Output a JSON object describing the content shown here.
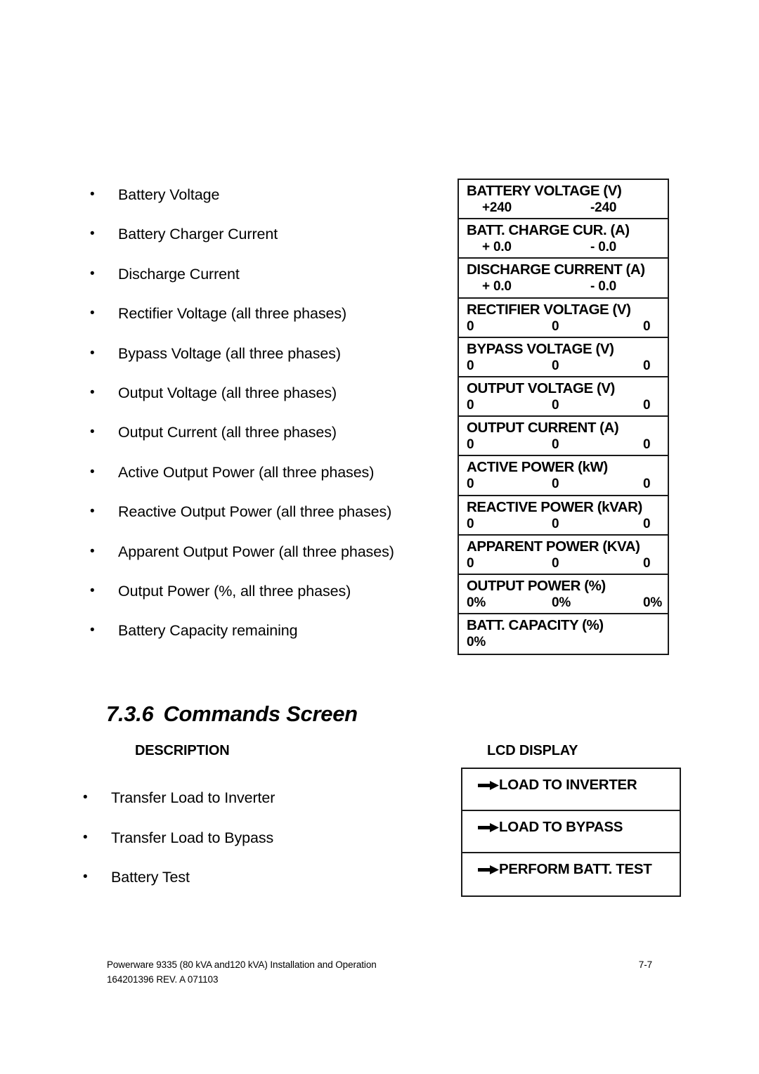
{
  "parameters_section": {
    "descriptions": [
      "Battery Voltage",
      "Battery Charger Current",
      "Discharge Current",
      "Rectifier Voltage (all three phases)",
      "Bypass Voltage (all three phases)",
      "Output Voltage (all three phases)",
      "Output Current (all three phases)",
      "Active Output Power (all three phases)",
      "Reactive Output Power (all three phases)",
      "Apparent Output Power (all three phases)",
      "Output Power (%, all three phases)",
      "Battery Capacity remaining"
    ],
    "bullet_glyph": "•",
    "lcd_rows": [
      {
        "label": "BATTERY VOLTAGE (V)",
        "values": [
          "+240",
          "-240"
        ],
        "layout": "vals-2"
      },
      {
        "label": "BATT. CHARGE CUR. (A)",
        "values": [
          "+ 0.0",
          "- 0.0"
        ],
        "layout": "vals-2"
      },
      {
        "label": "DISCHARGE CURRENT (A)",
        "values": [
          "+ 0.0",
          "- 0.0"
        ],
        "layout": "vals-2"
      },
      {
        "label": "RECTIFIER VOLTAGE (V)",
        "values": [
          "0",
          "0",
          "0"
        ],
        "layout": "vals-3"
      },
      {
        "label": "BYPASS VOLTAGE (V)",
        "values": [
          "0",
          "0",
          "0"
        ],
        "layout": "vals-3"
      },
      {
        "label": "OUTPUT VOLTAGE (V)",
        "values": [
          "0",
          "0",
          "0"
        ],
        "layout": "vals-3"
      },
      {
        "label": "OUTPUT CURRENT (A)",
        "values": [
          "0",
          "0",
          "0"
        ],
        "layout": "vals-3"
      },
      {
        "label": "ACTIVE POWER (kW)",
        "values": [
          "0",
          "0",
          "0"
        ],
        "layout": "vals-3"
      },
      {
        "label": "REACTIVE POWER (kVAR)",
        "values": [
          "0",
          "0",
          "0"
        ],
        "layout": "vals-3"
      },
      {
        "label": "APPARENT POWER (KVA)",
        "values": [
          "0",
          "0",
          "0"
        ],
        "layout": "vals-3"
      },
      {
        "label": "OUTPUT POWER  (%)",
        "values": [
          "0%",
          "0%",
          "0%"
        ],
        "layout": "vals-3"
      },
      {
        "label": "BATT. CAPACITY  (%)",
        "values": [
          "0%"
        ],
        "layout": "vals-1"
      }
    ]
  },
  "commands_section": {
    "heading_number": "7.3.6",
    "heading_title": "Commands Screen",
    "description_header": "DESCRIPTION",
    "lcd_display_header": "LCD DISPLAY",
    "descriptions": [
      "Transfer Load to Inverter",
      "Transfer Load to Bypass",
      "Battery Test"
    ],
    "lcd_commands": [
      "LOAD TO INVERTER",
      "LOAD TO BYPASS",
      "PERFORM BATT. TEST"
    ]
  },
  "footer": {
    "line1": "Powerware 9335 (80 kVA and120 kVA) Installation and Operation",
    "line2": "164201396 REV. A  071103",
    "page": "7-7"
  }
}
